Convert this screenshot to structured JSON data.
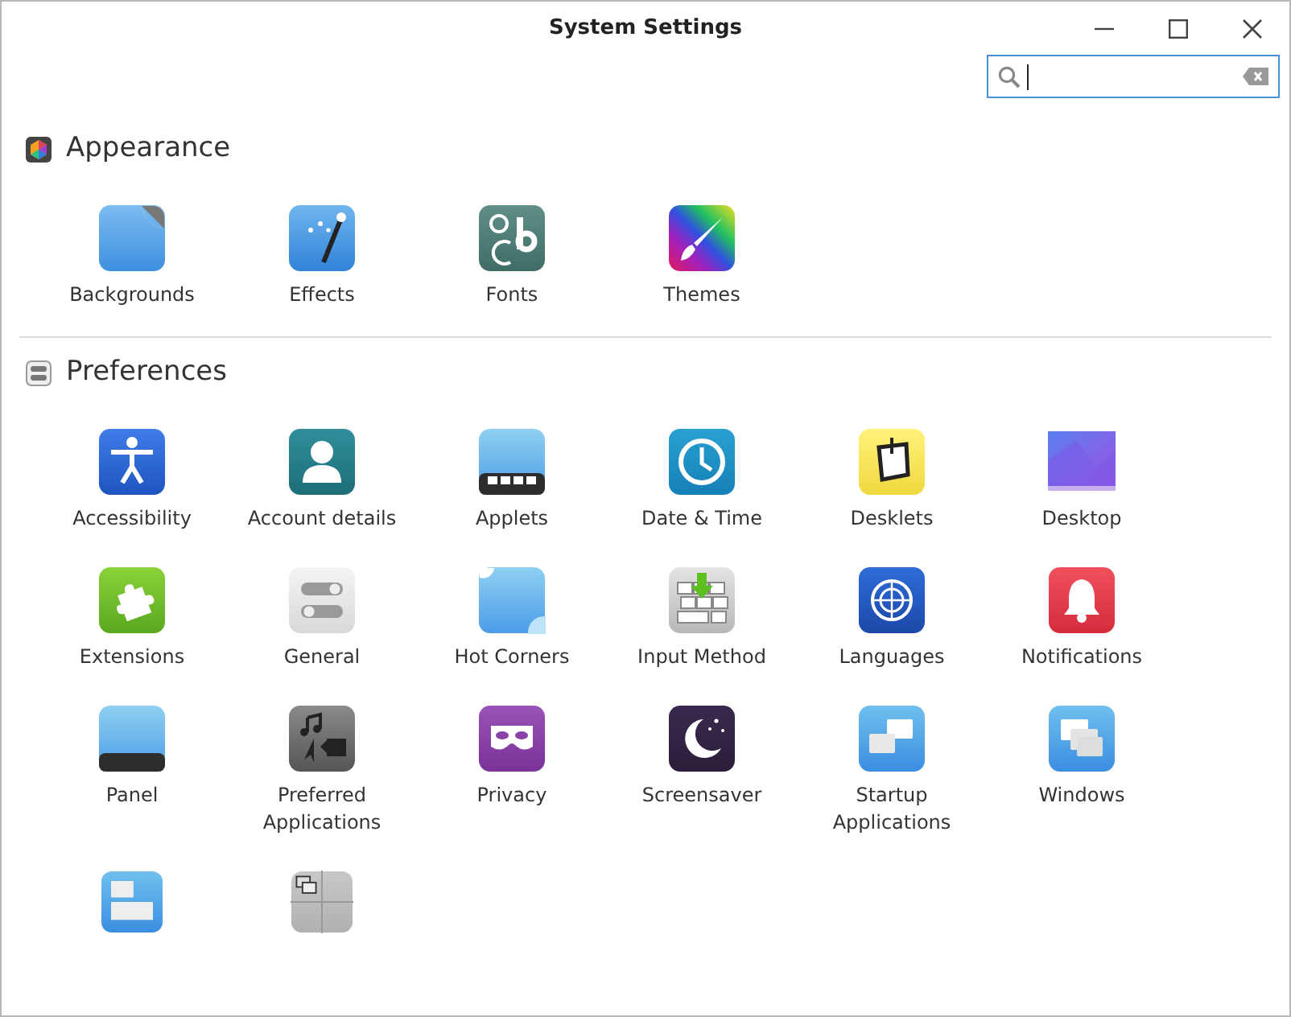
{
  "window": {
    "title": "System Settings"
  },
  "search": {
    "focused": true
  },
  "sections": [
    {
      "title": "Appearance",
      "kind": "appearance",
      "items": [
        {
          "label": "Backgrounds",
          "kind": "tile"
        },
        {
          "label": "Effects",
          "kind": "tile"
        },
        {
          "label": "Fonts",
          "kind": "tile"
        },
        {
          "label": "Themes",
          "kind": "tile"
        }
      ]
    },
    {
      "title": "Preferences",
      "kind": "preferences",
      "items": [
        {
          "label": "Accessibility",
          "kind": "tile"
        },
        {
          "label": "Account details",
          "kind": "tile"
        },
        {
          "label": "Applets",
          "kind": "tile"
        },
        {
          "label": "Date & Time",
          "kind": "tile"
        },
        {
          "label": "Desklets",
          "kind": "tile"
        },
        {
          "label": "Desktop",
          "kind": "tile"
        },
        {
          "label": "Extensions",
          "kind": "tile"
        },
        {
          "label": "General",
          "kind": "tile"
        },
        {
          "label": "Hot Corners",
          "kind": "tile"
        },
        {
          "label": "Input Method",
          "kind": "tile"
        },
        {
          "label": "Languages",
          "kind": "tile"
        },
        {
          "label": "Notifications",
          "kind": "tile"
        },
        {
          "label": "Panel",
          "kind": "tile"
        },
        {
          "label": "Preferred Applications",
          "kind": "tile"
        },
        {
          "label": "Privacy",
          "kind": "tile"
        },
        {
          "label": "Screensaver",
          "kind": "tile"
        },
        {
          "label": "Startup Applications",
          "kind": "tile"
        },
        {
          "label": "Windows",
          "kind": "tile"
        },
        {
          "kind": "partial"
        },
        {
          "kind": "partial"
        }
      ]
    }
  ]
}
